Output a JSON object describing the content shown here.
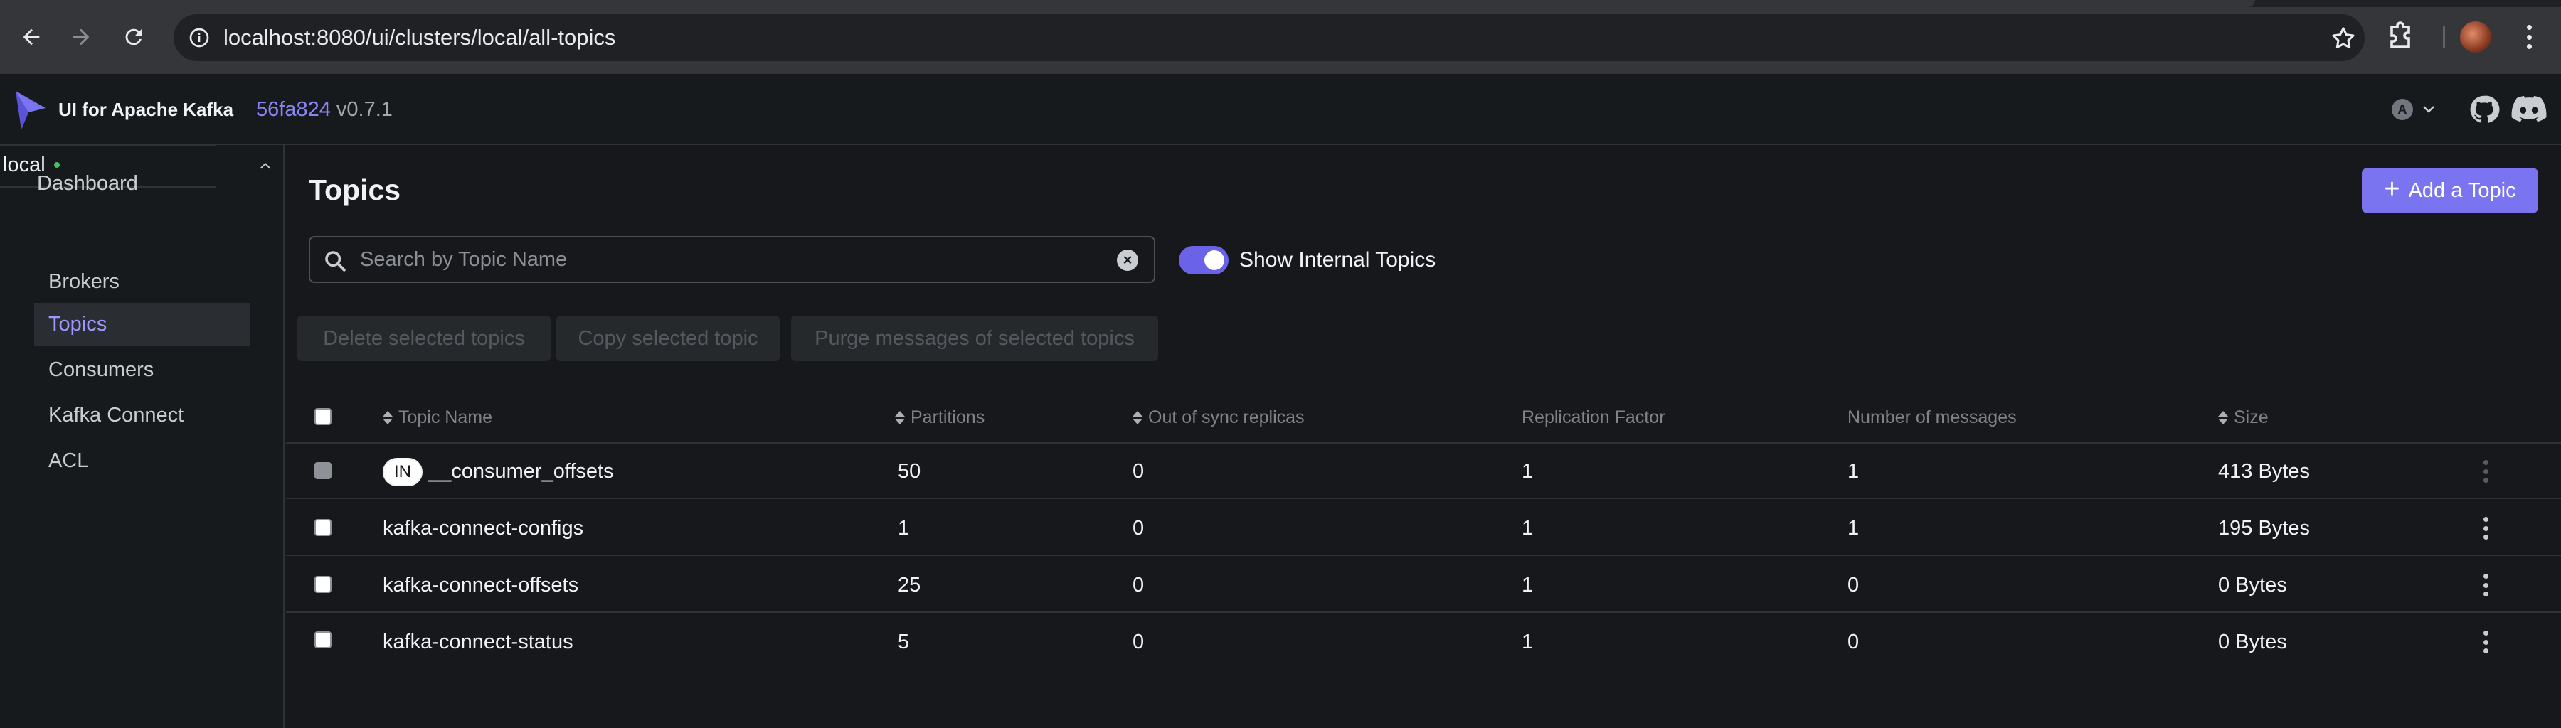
{
  "browser": {
    "url": "localhost:8080/ui/clusters/local/all-topics"
  },
  "header": {
    "brand": "UI for Apache Kafka",
    "commit": "56fa824",
    "version": "v0.7.1",
    "theme_letter": "A"
  },
  "sidebar": {
    "dashboard": "Dashboard",
    "cluster": "local",
    "items": [
      {
        "label": "Brokers"
      },
      {
        "label": "Topics"
      },
      {
        "label": "Consumers"
      },
      {
        "label": "Kafka Connect"
      },
      {
        "label": "ACL"
      }
    ]
  },
  "main": {
    "title": "Topics",
    "add_label": "Add a Topic",
    "search_placeholder": "Search by Topic Name",
    "toggle_label": "Show Internal Topics",
    "toggle_on": true,
    "bulk": {
      "delete": "Delete selected topics",
      "copy": "Copy selected topic",
      "purge": "Purge messages of selected topics"
    },
    "columns": {
      "name": "Topic Name",
      "partitions": "Partitions",
      "oos": "Out of sync replicas",
      "rf": "Replication Factor",
      "messages": "Number of messages",
      "size": "Size"
    },
    "internal_tag": "IN",
    "rows": [
      {
        "name": "__consumer_offsets",
        "partitions": "50",
        "oos": "0",
        "rf": "1",
        "messages": "1",
        "size": "413 Bytes"
      },
      {
        "name": "kafka-connect-configs",
        "partitions": "1",
        "oos": "0",
        "rf": "1",
        "messages": "1",
        "size": "195 Bytes"
      },
      {
        "name": "kafka-connect-offsets",
        "partitions": "25",
        "oos": "0",
        "rf": "1",
        "messages": "0",
        "size": "0 Bytes"
      },
      {
        "name": "kafka-connect-status",
        "partitions": "5",
        "oos": "0",
        "rf": "1",
        "messages": "0",
        "size": "0 Bytes"
      }
    ]
  }
}
